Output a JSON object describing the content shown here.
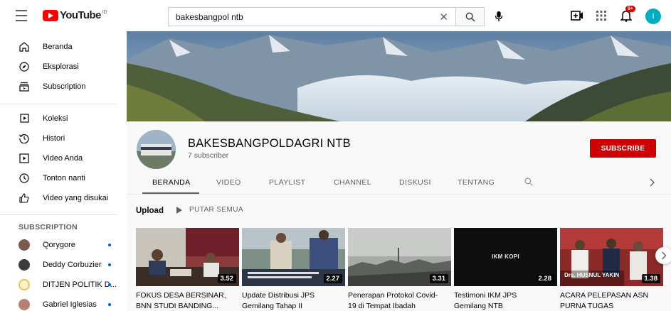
{
  "topbar": {
    "logo_text": "YouTube",
    "logo_sup": "ID",
    "search_value": "bakesbangpol ntb",
    "notif_count": "9+",
    "avatar_letter": "I"
  },
  "sidebar": {
    "items": [
      {
        "label": "Beranda",
        "icon": "home-icon"
      },
      {
        "label": "Eksplorasi",
        "icon": "compass-icon"
      },
      {
        "label": "Subscription",
        "icon": "subscriptions-icon"
      },
      {
        "label": "Koleksi",
        "icon": "library-icon"
      },
      {
        "label": "Histori",
        "icon": "history-icon"
      },
      {
        "label": "Video Anda",
        "icon": "your-videos-icon"
      },
      {
        "label": "Tonton nanti",
        "icon": "watch-later-icon"
      },
      {
        "label": "Video yang disukai",
        "icon": "liked-icon"
      }
    ],
    "section_title": "SUBSCRIPTION",
    "subscriptions": [
      {
        "name": "Qorygore",
        "color": "#7a5a4a"
      },
      {
        "name": "Deddy Corbuzier",
        "color": "#3b3b3b"
      },
      {
        "name": "DITJEN POLITIK D...",
        "color": "#f2c14e"
      },
      {
        "name": "Gabriel Iglesias",
        "color": "#b58070"
      }
    ]
  },
  "channel": {
    "name": "BAKESBANGPOLDAGRI NTB",
    "subscribers": "7 subscriber",
    "subscribe_label": "SUBSCRIBE",
    "avatar_text": "BAKESBANGPOL"
  },
  "tabs": [
    "BERANDA",
    "VIDEO",
    "PLAYLIST",
    "CHANNEL",
    "DISKUSI",
    "TENTANG"
  ],
  "uploads": {
    "title": "Upload",
    "play_all": "PUTAR SEMUA",
    "videos": [
      {
        "title_line1": "FOKUS DESA BERSINAR,",
        "title_line2": "BNN STUDI BANDING...",
        "duration": "3.52"
      },
      {
        "title_line1": "Update Distribusi JPS",
        "title_line2": "Gemilang Tahap II",
        "duration": "2.27"
      },
      {
        "title_line1": "Penerapan Protokol Covid-",
        "title_line2": "19 di Tempat Ibadah",
        "duration": "3.31"
      },
      {
        "title_line1": "Testimoni IKM JPS",
        "title_line2": "Gemilang NTB",
        "duration": "2.28",
        "overlay": "IKM KOPI"
      },
      {
        "title_line1": "ACARA PELEPASAN ASN",
        "title_line2": "PURNA TUGAS",
        "duration": "1.38",
        "overlay": "Drs. HUSNUL YAKIN"
      }
    ]
  },
  "colors": {
    "accent_red": "#cc0000",
    "link_blue": "#065fd4"
  }
}
